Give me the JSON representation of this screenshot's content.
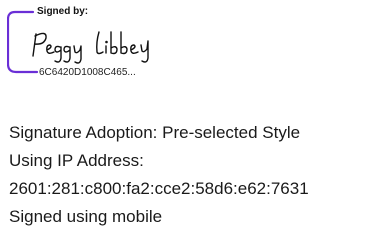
{
  "signature": {
    "header": "Signed by:",
    "signer_name": "Peggy Libbey",
    "signature_id": "6C6420D1008C465...",
    "frame_color": "#6a2fd6"
  },
  "details": {
    "adoption": "Signature Adoption: Pre-selected Style",
    "ip_label": "Using IP Address:",
    "ip_address": "2601:281:c800:fa2:cce2:58d6:e62:7631",
    "device": "Signed using mobile"
  }
}
